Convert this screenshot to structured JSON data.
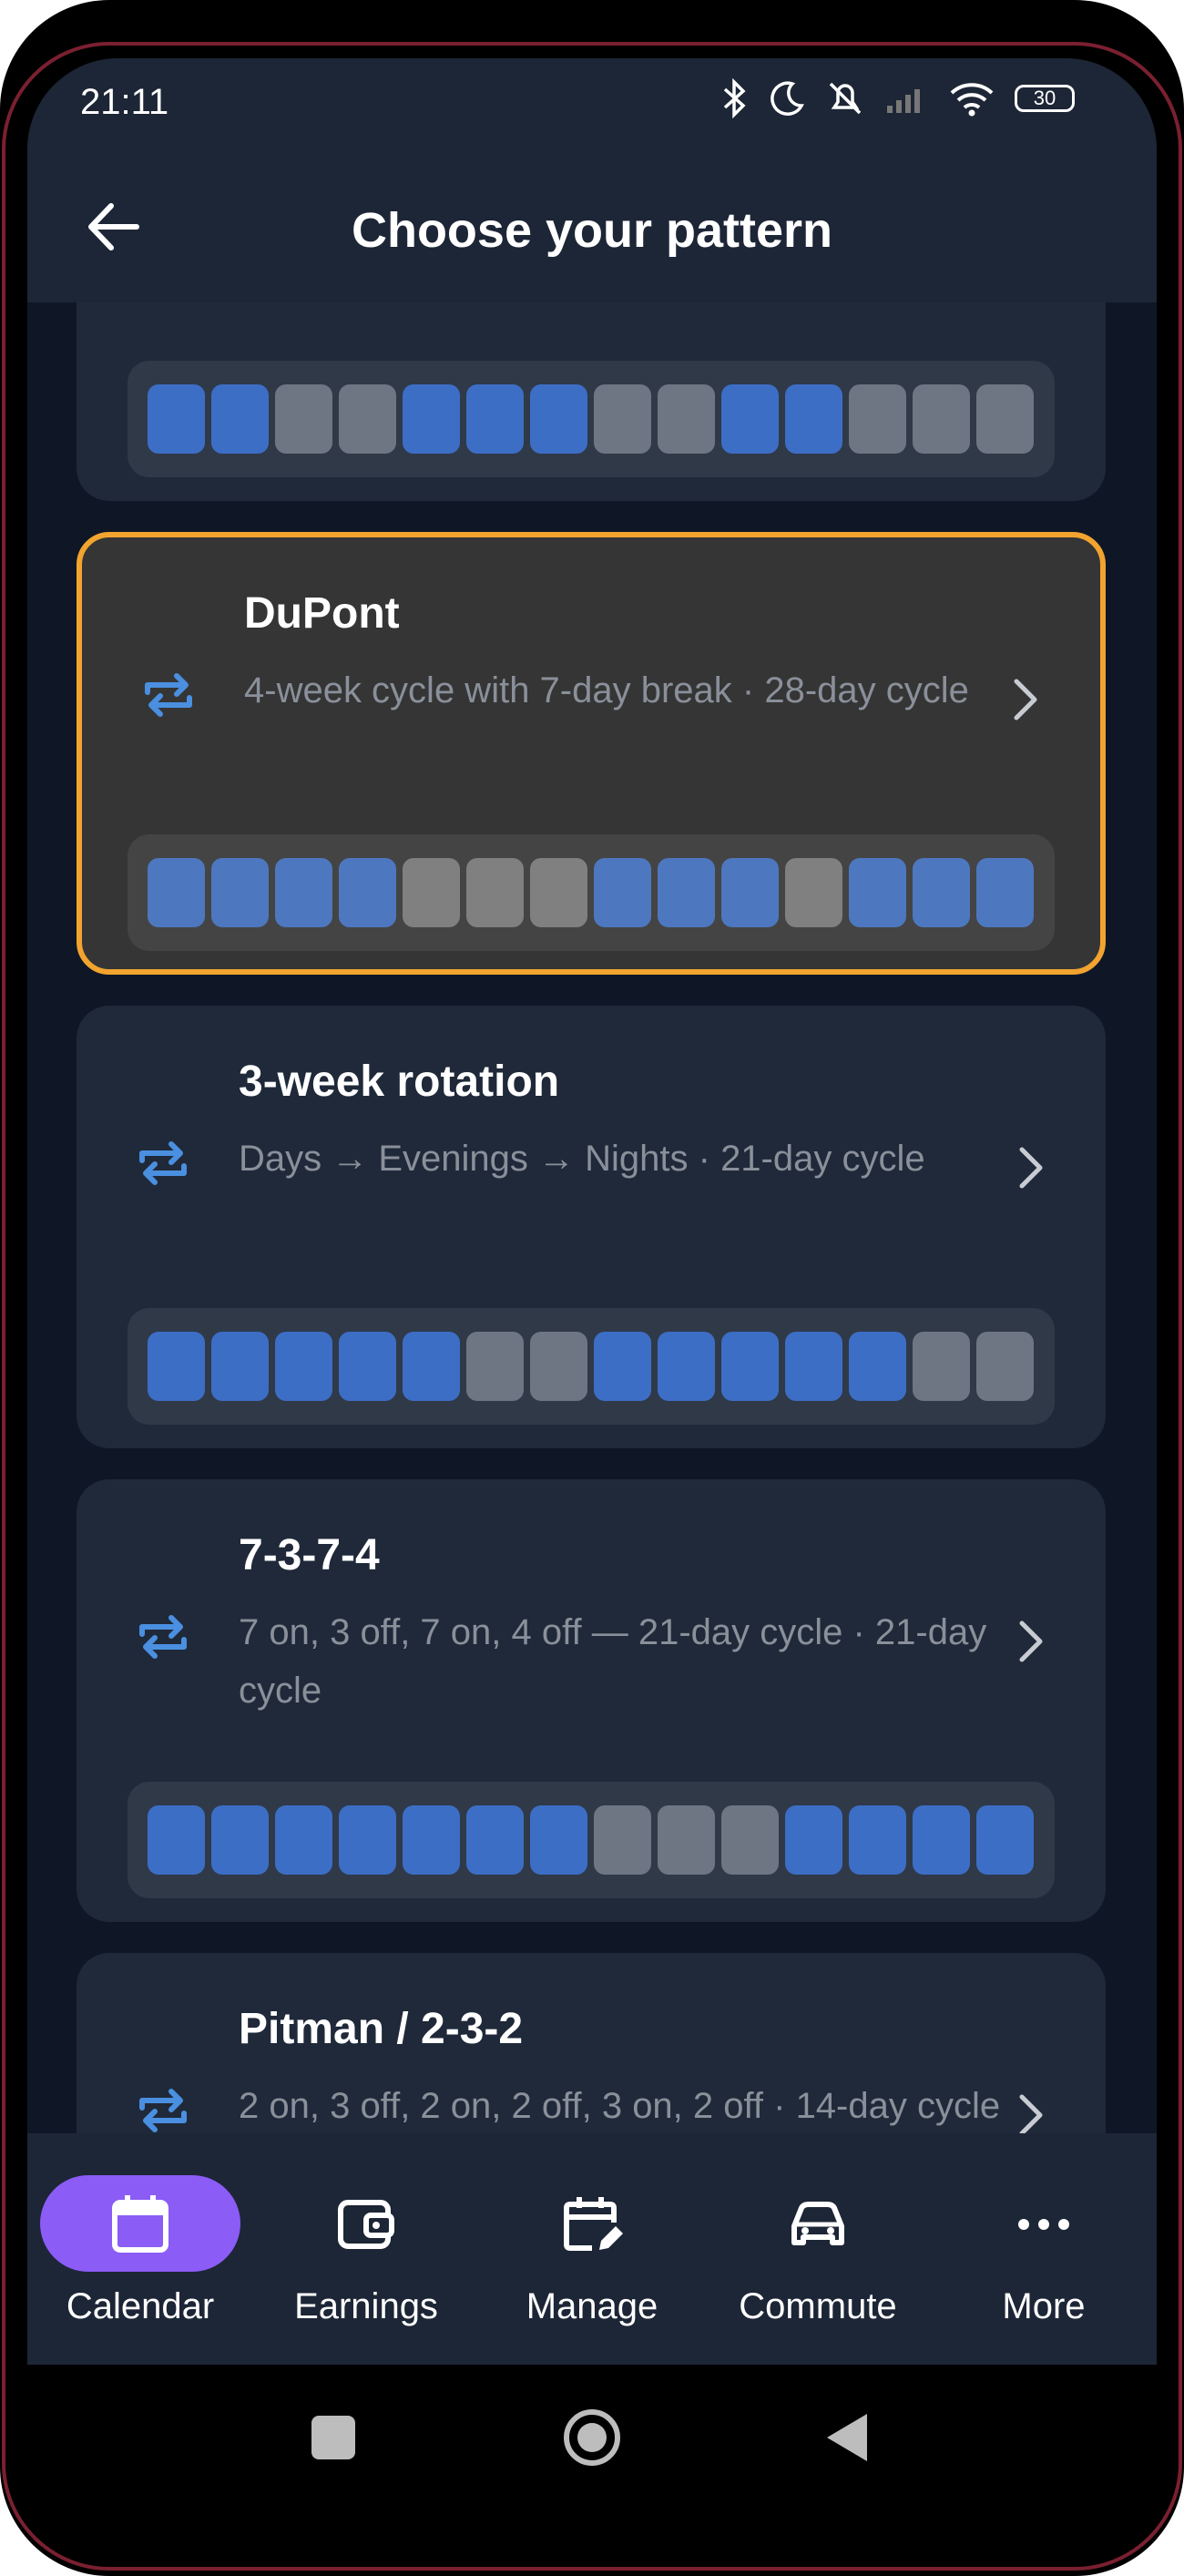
{
  "status_bar": {
    "time": "21:11",
    "battery": "30"
  },
  "header": {
    "title": "Choose your pattern"
  },
  "patterns": [
    {
      "title": "",
      "subtitle": "",
      "strip": [
        "on",
        "on",
        "off",
        "off",
        "on",
        "on",
        "on",
        "off",
        "off",
        "on",
        "on",
        "off",
        "off",
        "off"
      ],
      "selected": false
    },
    {
      "title": "DuPont",
      "subtitle": "4-week cycle with 7-day break · 28-day cycle",
      "strip": [
        "on",
        "on",
        "on",
        "on",
        "off",
        "off",
        "off",
        "on",
        "on",
        "on",
        "off",
        "on",
        "on",
        "on"
      ],
      "selected": true
    },
    {
      "title": "3-week rotation",
      "subtitle": "Days → Evenings → Nights · 21-day cycle",
      "strip": [
        "on",
        "on",
        "on",
        "on",
        "on",
        "off",
        "off",
        "on",
        "on",
        "on",
        "on",
        "on",
        "off",
        "off"
      ],
      "selected": false
    },
    {
      "title": "7-3-7-4",
      "subtitle": "7 on, 3 off, 7 on, 4 off — 21-day cycle · 21-day cycle",
      "strip": [
        "on",
        "on",
        "on",
        "on",
        "on",
        "on",
        "on",
        "off",
        "off",
        "off",
        "on",
        "on",
        "on",
        "on"
      ],
      "selected": false
    },
    {
      "title": "Pitman / 2-3-2",
      "subtitle": "2 on, 3 off, 2 on, 2 off, 3 on, 2 off · 14-day cycle",
      "strip": [
        "on",
        "on",
        "off",
        "off",
        "off",
        "on",
        "on",
        "off",
        "off",
        "on",
        "on",
        "on",
        "off",
        "off"
      ],
      "selected": false
    }
  ],
  "bottom_nav": [
    {
      "label": "Calendar",
      "icon": "calendar-icon",
      "active": true
    },
    {
      "label": "Earnings",
      "icon": "wallet-icon",
      "active": false
    },
    {
      "label": "Manage",
      "icon": "calendar-edit-icon",
      "active": false
    },
    {
      "label": "Commute",
      "icon": "car-icon",
      "active": false
    },
    {
      "label": "More",
      "icon": "more-dots-icon",
      "active": false
    }
  ],
  "colors": {
    "accent": "#8b5cf6",
    "selected_border": "#f2a42f",
    "on_cell": "#3d6ec6",
    "off_cell": "#6e7683",
    "repeat_icon": "#4a8fe0"
  }
}
